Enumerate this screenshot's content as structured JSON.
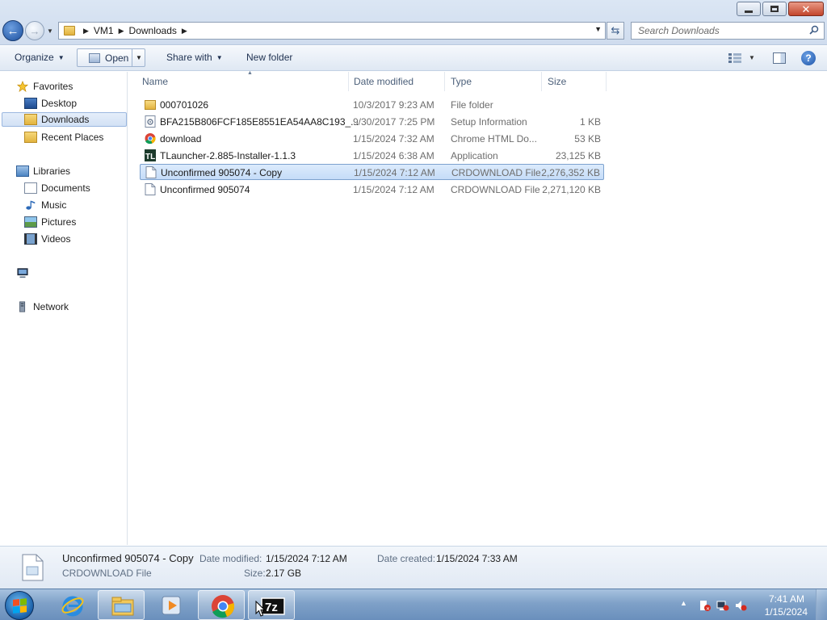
{
  "window": {
    "breadcrumb": [
      "VM1",
      "Downloads"
    ],
    "search_placeholder": "Search Downloads"
  },
  "toolbar": {
    "organize": "Organize",
    "open": "Open",
    "share_with": "Share with",
    "new_folder": "New folder"
  },
  "nav": {
    "favorites": "Favorites",
    "desktop": "Desktop",
    "downloads": "Downloads",
    "recent_places": "Recent Places",
    "libraries": "Libraries",
    "documents": "Documents",
    "music": "Music",
    "pictures": "Pictures",
    "videos": "Videos",
    "network": "Network"
  },
  "columns": {
    "name": "Name",
    "date": "Date modified",
    "type": "Type",
    "size": "Size"
  },
  "files": [
    {
      "name": "000701026",
      "date": "10/3/2017 9:23 AM",
      "type": "File folder",
      "size": "",
      "icon": "folder-icon"
    },
    {
      "name": "BFA215B806FCF185E8551EA54AA8C193_...",
      "date": "9/30/2017 7:25 PM",
      "type": "Setup Information",
      "size": "1 KB",
      "icon": "setup-info-icon"
    },
    {
      "name": "download",
      "date": "1/15/2024 7:32 AM",
      "type": "Chrome HTML Do...",
      "size": "53 KB",
      "icon": "chrome-icon"
    },
    {
      "name": "TLauncher-2.885-Installer-1.1.3",
      "date": "1/15/2024 6:38 AM",
      "type": "Application",
      "size": "23,125 KB",
      "icon": "tlauncher-icon"
    },
    {
      "name": "Unconfirmed 905074 - Copy",
      "date": "1/15/2024 7:12 AM",
      "type": "CRDOWNLOAD File",
      "size": "2,276,352 KB",
      "icon": "file-icon",
      "selected": true
    },
    {
      "name": "Unconfirmed 905074",
      "date": "1/15/2024 7:12 AM",
      "type": "CRDOWNLOAD File",
      "size": "2,271,120 KB",
      "icon": "file-icon"
    }
  ],
  "details": {
    "name": "Unconfirmed 905074 - Copy",
    "type": "CRDOWNLOAD File",
    "date_modified_label": "Date modified:",
    "date_modified": "1/15/2024 7:12 AM",
    "size_label": "Size:",
    "size": "2.17 GB",
    "date_created_label": "Date created:",
    "date_created": "1/15/2024 7:33 AM"
  },
  "taskbar": {
    "apps": [
      "ie-icon",
      "explorer-icon",
      "media-player-icon",
      "chrome-icon",
      "7zip-icon"
    ],
    "time": "7:41 AM",
    "date": "1/15/2024"
  },
  "colors": {
    "selection": "#cce0f8",
    "accent": "#1c53a8"
  }
}
